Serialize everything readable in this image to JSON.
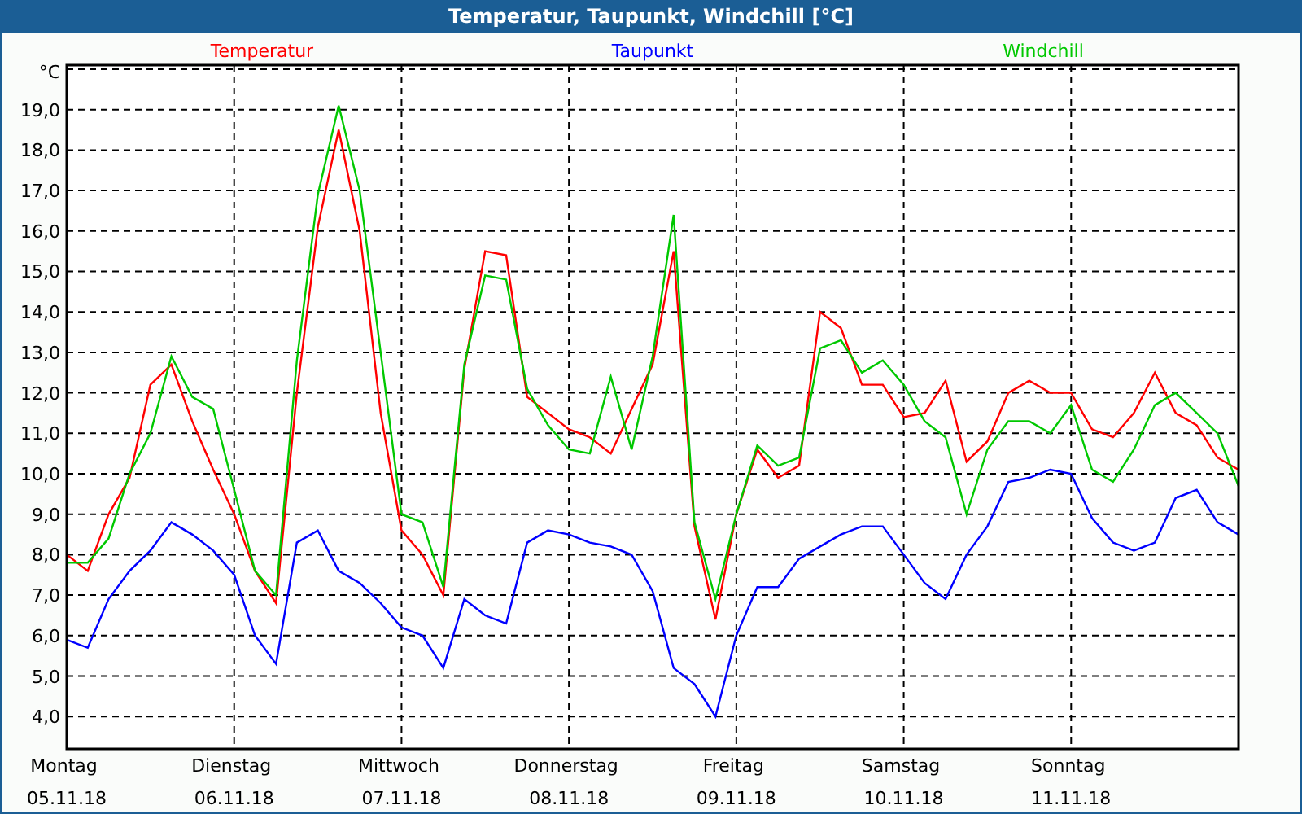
{
  "window": {
    "title": "Temperatur, Taupunkt, Windchill [°C]"
  },
  "chart": {
    "chart_data": {
      "type": "line",
      "grid": true,
      "ylabel": "°C",
      "categories": [
        "Montag 05.11.18",
        null,
        null,
        null,
        null,
        null,
        null,
        null,
        "Dienstag 06.11.18",
        null,
        null,
        null,
        null,
        null,
        null,
        null,
        "Mittwoch 07.11.18",
        null,
        null,
        null,
        null,
        null,
        null,
        null,
        "Donnerstag 08.11.18",
        null,
        null,
        null,
        null,
        null,
        null,
        null,
        "Freitag 09.11.18",
        null,
        null,
        null,
        null,
        null,
        null,
        null,
        "Samstag 10.11.18",
        null,
        null,
        null,
        null,
        null,
        null,
        null,
        "Sonntag 11.11.18",
        null,
        null,
        null,
        null,
        null,
        null,
        null,
        null
      ],
      "ylim": [
        3.2,
        20.1
      ],
      "yticks": [
        {
          "value": 4,
          "label": "4,0"
        },
        {
          "value": 5,
          "label": "5,0"
        },
        {
          "value": 6,
          "label": "6,0"
        },
        {
          "value": 7,
          "label": "7,0"
        },
        {
          "value": 8,
          "label": "8,0"
        },
        {
          "value": 9,
          "label": "9,0"
        },
        {
          "value": 10,
          "label": "10,0"
        },
        {
          "value": 11,
          "label": "11,0"
        },
        {
          "value": 12,
          "label": "12,0"
        },
        {
          "value": 13,
          "label": "13,0"
        },
        {
          "value": 14,
          "label": "14,0"
        },
        {
          "value": 15,
          "label": "15,0"
        },
        {
          "value": 16,
          "label": "16,0"
        },
        {
          "value": 17,
          "label": "17,0"
        },
        {
          "value": 18,
          "label": "18,0"
        },
        {
          "value": 19,
          "label": "19,0"
        }
      ],
      "series": [
        {
          "name": "Temperatur",
          "color": "#ff0000",
          "values": [
            8.0,
            7.6,
            9.0,
            9.9,
            12.2,
            12.7,
            11.3,
            10.1,
            9.0,
            7.6,
            6.8,
            12.0,
            16.1,
            18.5,
            16.0,
            11.5,
            8.6,
            8.0,
            7.0,
            12.6,
            15.5,
            15.4,
            11.9,
            11.5,
            11.1,
            10.9,
            10.5,
            11.6,
            12.7,
            15.5,
            8.7,
            6.4,
            9.0,
            10.6,
            9.9,
            10.2,
            14.0,
            13.6,
            12.2,
            12.2,
            11.4,
            11.5,
            12.3,
            10.3,
            10.8,
            12.0,
            12.3,
            12.0,
            12.0,
            11.1,
            10.9,
            11.5,
            12.5,
            11.5,
            11.2,
            10.4,
            10.1
          ]
        },
        {
          "name": "Taupunkt",
          "color": "#0000ff",
          "values": [
            5.9,
            5.7,
            6.9,
            7.6,
            8.1,
            8.8,
            8.5,
            8.1,
            7.5,
            6.0,
            5.3,
            8.3,
            8.6,
            7.6,
            7.3,
            6.8,
            6.2,
            6.0,
            5.2,
            6.9,
            6.5,
            6.3,
            8.3,
            8.6,
            8.5,
            8.3,
            8.2,
            8.0,
            7.1,
            5.2,
            4.8,
            4.0,
            6.0,
            7.2,
            7.2,
            7.9,
            8.2,
            8.5,
            8.7,
            8.7,
            8.0,
            7.3,
            6.9,
            8.0,
            8.7,
            9.8,
            9.9,
            10.1,
            10.0,
            8.9,
            8.3,
            8.1,
            8.3,
            9.4,
            9.6,
            8.8,
            8.5
          ]
        },
        {
          "name": "Windchill",
          "color": "#00c800",
          "values": [
            7.8,
            7.8,
            8.4,
            10.0,
            11.0,
            12.9,
            11.9,
            11.6,
            9.6,
            7.6,
            7.0,
            12.8,
            16.9,
            19.1,
            17.0,
            13.0,
            9.0,
            8.8,
            7.2,
            12.7,
            14.9,
            14.8,
            12.1,
            11.2,
            10.6,
            10.5,
            12.4,
            10.6,
            12.9,
            16.4,
            8.8,
            6.9,
            9.0,
            10.7,
            10.2,
            10.4,
            13.1,
            13.3,
            12.5,
            12.8,
            12.2,
            11.3,
            10.9,
            9.0,
            10.6,
            11.3,
            11.3,
            11.0,
            11.7,
            10.1,
            9.8,
            10.6,
            11.7,
            12.0,
            11.5,
            11.0,
            9.7
          ]
        }
      ]
    }
  }
}
